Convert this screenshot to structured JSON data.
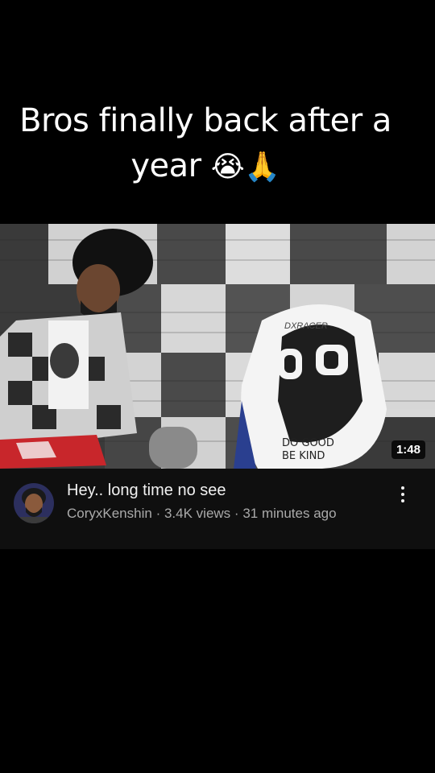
{
  "caption": {
    "text": "Bros finally back after a year",
    "emojis": "😭🙏"
  },
  "video": {
    "duration": "1:48",
    "chair_brand": "DXRACER",
    "chair_text_line1": "DO GOOD",
    "chair_text_line2": "BE KIND",
    "title": "Hey.. long time no see",
    "channel": "CoryxKenshin",
    "views": "3.4K views",
    "age": "31 minutes ago",
    "separator": "·"
  },
  "colors": {
    "background": "#000000",
    "card_background": "#0f0f0f",
    "title_color": "#f1f1f1",
    "meta_color": "#aaaaaa"
  },
  "icons": {
    "more": "more-vertical-icon",
    "avatar": "channel-avatar"
  }
}
